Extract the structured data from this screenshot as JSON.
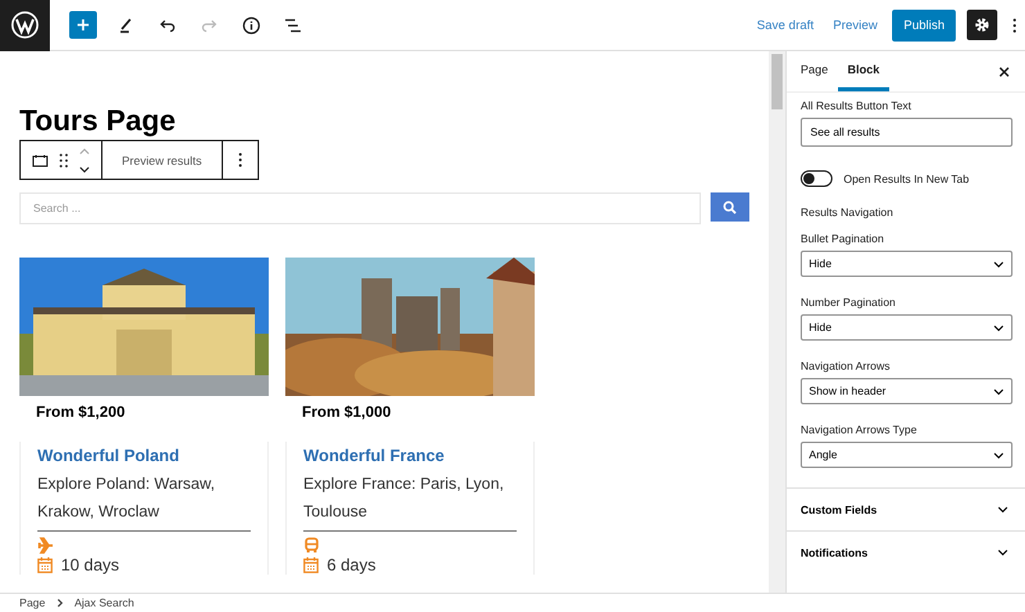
{
  "top_bar": {
    "actions": [
      {
        "label": "Save draft",
        "kind": "link"
      },
      {
        "label": "Preview",
        "kind": "link"
      },
      {
        "label": "Publish",
        "kind": "primary"
      }
    ],
    "settings_active": true
  },
  "editor": {
    "title": "Tours Page",
    "block_toolbar": {
      "label": "Preview results"
    },
    "search": {
      "placeholder": "Search ..."
    },
    "tours": [
      {
        "price": "From $1,200",
        "name": "Wonderful Poland",
        "description": "Explore Poland: Warsaw, Krakow, Wroclaw",
        "transport": {
          "kind": "plane"
        },
        "duration": "10 days"
      },
      {
        "price": "From $1,000",
        "name": "Wonderful France",
        "description": "Explore France: Paris, Lyon, Toulouse",
        "transport": {
          "kind": "bus"
        },
        "duration": "6 days"
      }
    ]
  },
  "sidebar": {
    "tabs": [
      {
        "label": "Page",
        "selected": false
      },
      {
        "label": "Block",
        "selected": true
      }
    ],
    "controls": [
      {
        "kind": "text",
        "label": "All Results Button Text",
        "value": "See all results"
      },
      {
        "kind": "toggle",
        "label": "Open Results In New Tab",
        "on": false
      },
      {
        "kind": "heading",
        "label": "Results Navigation"
      },
      {
        "kind": "select",
        "label": "Bullet Pagination",
        "value": "Hide"
      },
      {
        "kind": "select",
        "label": "Number Pagination",
        "value": "Hide"
      },
      {
        "kind": "select",
        "label": "Navigation Arrows",
        "value": "Show in header"
      },
      {
        "kind": "select",
        "label": "Navigation Arrows Type",
        "value": "Angle"
      }
    ],
    "panels": [
      {
        "label": "Custom Fields",
        "expanded": false
      },
      {
        "label": "Notifications",
        "expanded": false
      }
    ]
  },
  "breadcrumb": [
    "Page",
    "Ajax Search"
  ]
}
